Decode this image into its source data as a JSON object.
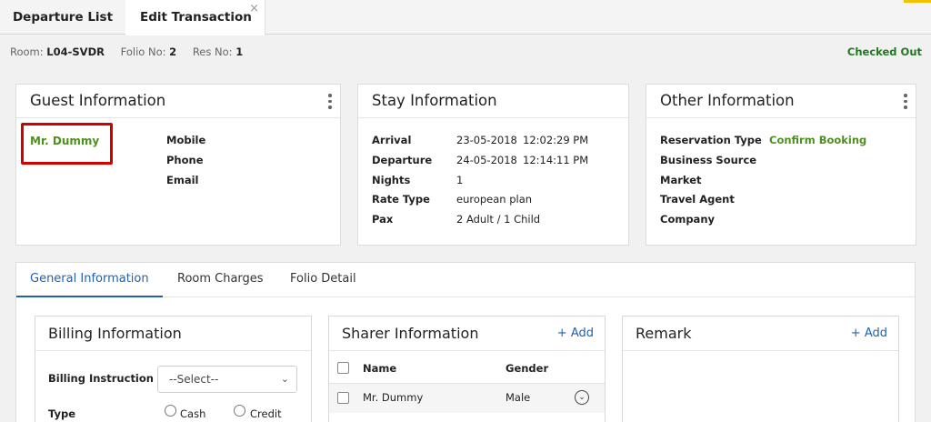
{
  "tabs": [
    {
      "label": "Departure List"
    },
    {
      "label": "Edit Transaction",
      "close": "×"
    }
  ],
  "infobar": {
    "room_label": "Room:",
    "room_value": "L04-SVDR",
    "folio_label": "Folio No:",
    "folio_value": "2",
    "res_label": "Res No:",
    "res_value": "1",
    "status": "Checked Out"
  },
  "guest": {
    "title": "Guest Information",
    "name": "Mr. Dummy",
    "fields": [
      "Mobile",
      "Phone",
      "Email"
    ]
  },
  "stay": {
    "title": "Stay Information",
    "rows": [
      {
        "label": "Arrival",
        "value": "23-05-2018",
        "time": "12:02:29 PM"
      },
      {
        "label": "Departure",
        "value": "24-05-2018",
        "time": "12:14:11 PM"
      },
      {
        "label": "Nights",
        "value": "1",
        "time": ""
      },
      {
        "label": "Rate Type",
        "value": "european plan",
        "time": ""
      },
      {
        "label": "Pax",
        "value": "2 Adult / 1 Child",
        "time": ""
      }
    ]
  },
  "other": {
    "title": "Other Information",
    "rows": [
      {
        "label": "Reservation Type",
        "value": "Confirm Booking"
      },
      {
        "label": "Business Source",
        "value": ""
      },
      {
        "label": "Market",
        "value": ""
      },
      {
        "label": "Travel Agent",
        "value": ""
      },
      {
        "label": "Company",
        "value": ""
      }
    ]
  },
  "subtabs": [
    "General Information",
    "Room Charges",
    "Folio Detail"
  ],
  "billing": {
    "title": "Billing Information",
    "instruction_label": "Billing Instruction",
    "instruction_value": "--Select--",
    "type_label": "Type",
    "options": [
      "Cash",
      "Credit"
    ]
  },
  "sharer": {
    "title": "Sharer Information",
    "add": "+ Add",
    "columns": [
      "Name",
      "Gender"
    ],
    "rows": [
      {
        "name": "Mr. Dummy",
        "gender": "Male"
      }
    ]
  },
  "remark": {
    "title": "Remark",
    "add": "+ Add"
  },
  "icons": {
    "kebab": "kebab-menu-icon",
    "chevron": "chevron-down-icon",
    "close": "close-icon"
  },
  "colors": {
    "accent_green": "#4f8f1f",
    "link_blue": "#1e62b0",
    "highlight_red": "#d40000"
  }
}
